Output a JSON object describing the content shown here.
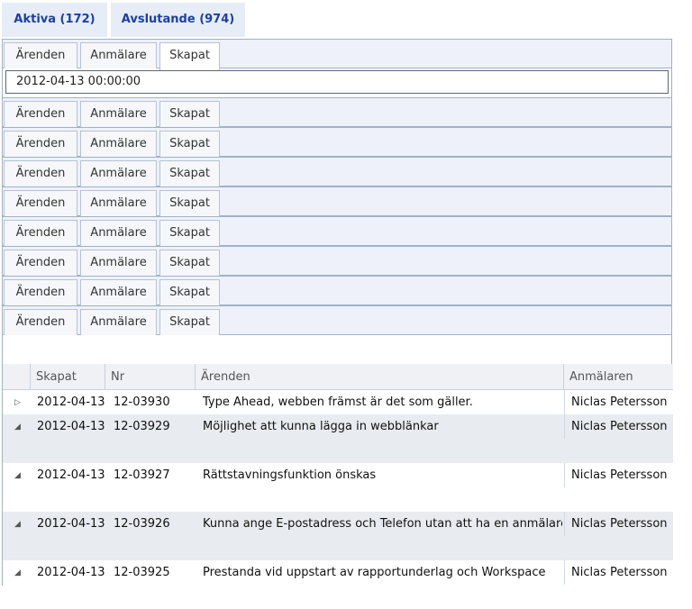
{
  "top_tabs": [
    {
      "label": "Aktiva (172)"
    },
    {
      "label": "Avslutande (974)"
    }
  ],
  "filter_tabs": {
    "t1": "Ärenden",
    "t2": "Anmälare",
    "t3": "Skapat"
  },
  "filter_value": "2012-04-13 00:00:00",
  "grid": {
    "columns": {
      "skapat": "Skapat",
      "nr": "Nr",
      "arenden": "Ärenden",
      "anmalaren": "Anmälaren"
    },
    "rows": [
      {
        "skapat": "2012-04-13",
        "nr": "12-03930",
        "arenden": "Type Ahead, webben främst är det som gäller.",
        "anmalaren": "Niclas Petersson",
        "expanded": false
      },
      {
        "skapat": "2012-04-13",
        "nr": "12-03929",
        "arenden": "Möjlighet att kunna lägga in webblänkar",
        "anmalaren": "Niclas Petersson",
        "expanded": true
      },
      {
        "skapat": "2012-04-13",
        "nr": "12-03927",
        "arenden": "Rättstavningsfunktion önskas",
        "anmalaren": "Niclas Petersson",
        "expanded": true
      },
      {
        "skapat": "2012-04-13",
        "nr": "12-03926",
        "arenden": "Kunna ange E-postadress och Telefon utan att ha en anmälare",
        "anmalaren": "Niclas Petersson",
        "expanded": true
      },
      {
        "skapat": "2012-04-13",
        "nr": "12-03925",
        "arenden": "Prestanda vid uppstart av rapportunderlag och Workspace",
        "anmalaren": "Niclas Petersson",
        "expanded": true
      }
    ]
  }
}
